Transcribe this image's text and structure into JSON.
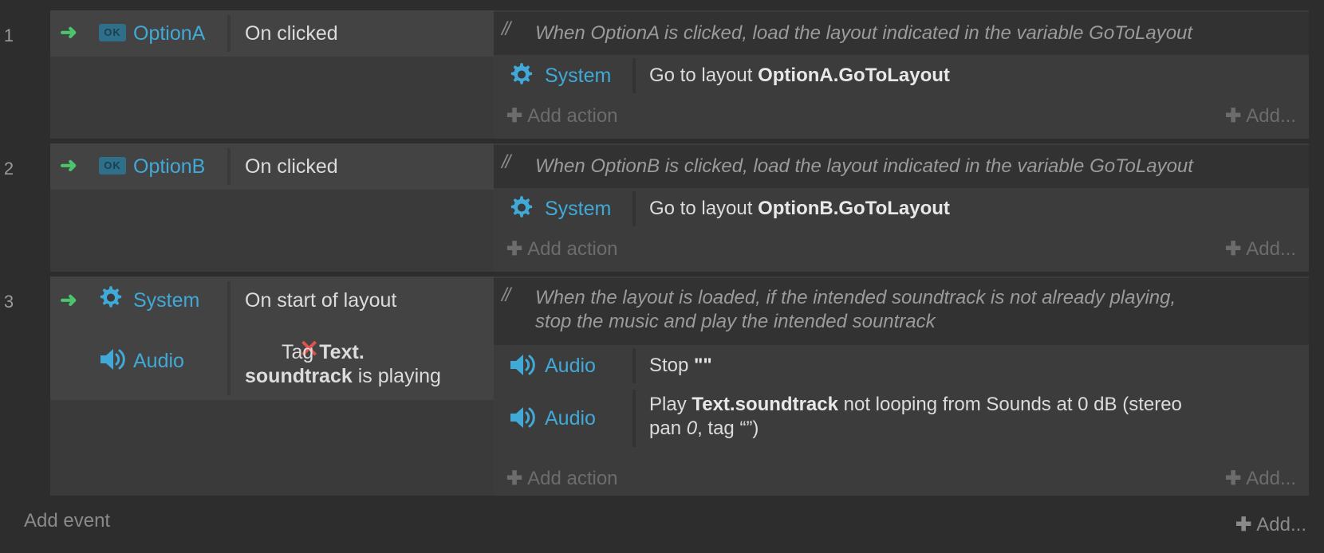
{
  "colors": {
    "background": "#2d2d2d",
    "object_name": "#41a9d8",
    "trigger_arrow": "#4bc46b",
    "invert_x": "#e0524b"
  },
  "events": [
    {
      "number": "1",
      "conditions": [
        {
          "icon": "ok-button-icon",
          "object": "OptionA",
          "text": "On clicked"
        }
      ],
      "comment": "When OptionA is clicked, load the layout indicated in the variable GoToLayout",
      "actions": [
        {
          "icon": "gear-icon",
          "object": "System",
          "text_prefix": "Go to layout ",
          "text_bold": "OptionA.GoToLayout"
        }
      ],
      "add_action": "Add action",
      "add_more": "Add..."
    },
    {
      "number": "2",
      "conditions": [
        {
          "icon": "ok-button-icon",
          "object": "OptionB",
          "text": "On clicked"
        }
      ],
      "comment": "When OptionB is clicked, load the layout indicated in the variable GoToLayout",
      "actions": [
        {
          "icon": "gear-icon",
          "object": "System",
          "text_prefix": "Go to layout ",
          "text_bold": "OptionB.GoToLayout"
        }
      ],
      "add_action": "Add action",
      "add_more": "Add..."
    },
    {
      "number": "3",
      "conditions": [
        {
          "icon": "gear-icon",
          "object": "System",
          "text": "On start of layout"
        },
        {
          "icon": "speaker-icon",
          "object": "Audio",
          "inverted": true,
          "text_prefix": "Tag ",
          "text_bold_1": "Text.",
          "text_bold_2": "soundtrack",
          "text_suffix": " is playing"
        }
      ],
      "comment_line1": "When the layout is loaded, if the intended soundtrack is not already playing,",
      "comment_line2": "stop the music and play the intended sountrack",
      "actions": [
        {
          "icon": "speaker-icon",
          "object": "Audio",
          "text_prefix": "Stop ",
          "text_bold": "\"\""
        },
        {
          "icon": "speaker-icon",
          "object": "Audio",
          "text_prefix": "Play ",
          "text_bold": "Text.soundtrack",
          "text_mid": " not looping from Sounds at 0 dB (stereo",
          "text_line2_prefix": "pan ",
          "text_italic": "0",
          "text_line2_suffix": ", tag “”)"
        }
      ],
      "add_action": "Add action",
      "add_more": "Add..."
    }
  ],
  "footer": {
    "add_event": "Add event",
    "add_more": "Add..."
  }
}
